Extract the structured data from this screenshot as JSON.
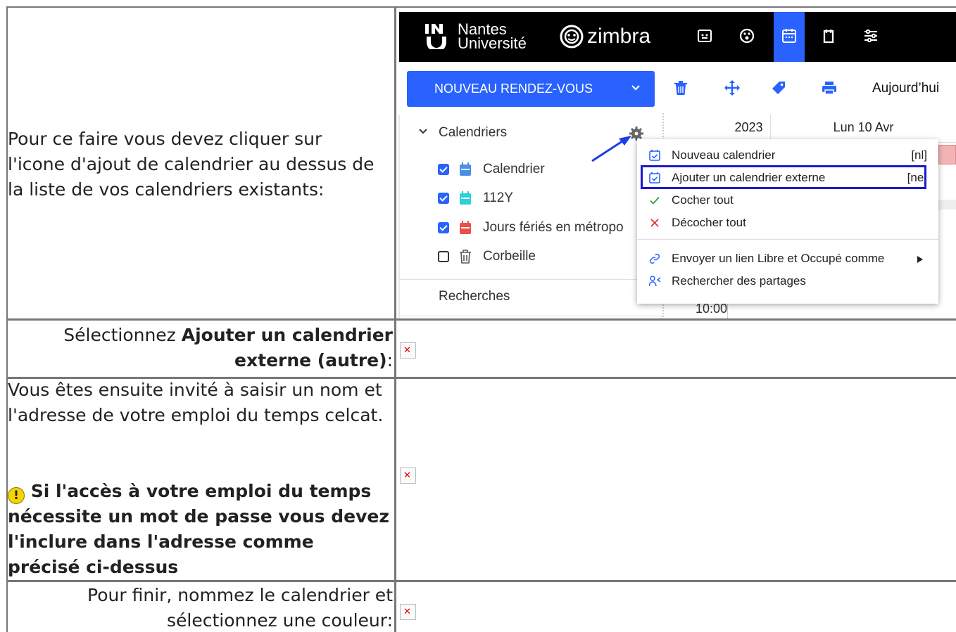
{
  "rows": [
    {
      "text": "Pour ce faire vous devez cliquer sur l'icone d'ajout de calendrier au dessus de la liste de vos calendriers existants:"
    },
    {
      "prefix": "Sélectionnez ",
      "bold": "Ajouter un calendrier externe (autre)",
      "suffix": ":"
    },
    {
      "text": "Vous êtes ensuite invité à saisir un nom et l'adresse de votre emploi du temps celcat.",
      "warning": "Si l'accès à votre emploi du temps nécessite un mot de passe vous devez l'inclure dans l'adresse comme précisé ci-dessus"
    },
    {
      "text": "Pour finir, nommez le calendrier et sélectionnez une couleur:"
    }
  ],
  "zimbra": {
    "brand_line1": "Nantes",
    "brand_line2": "Université",
    "zimbra_label": "zimbra",
    "new_button": "NOUVEAU RENDEZ-VOUS",
    "today": "Aujourd’hui",
    "calendars_header": "Calendriers",
    "calendars": [
      {
        "name": "Calendrier",
        "checked": true,
        "color": "#4a8fe7"
      },
      {
        "name": "112Y",
        "checked": true,
        "color": "#2ecfd8"
      },
      {
        "name": "Jours fériés en métropo",
        "checked": true,
        "color": "#e8504a"
      },
      {
        "name": "Corbeille",
        "checked": false,
        "color": "#555555"
      }
    ],
    "searches": "Recherches",
    "cal_year": "2023",
    "cal_day": "Lun 10 Avr",
    "cal_time": "10:00",
    "menu": [
      {
        "label": "Nouveau calendrier",
        "shortcut": "[nl]",
        "icon": "calendar-check-icon"
      },
      {
        "label": "Ajouter un calendrier externe",
        "shortcut": "[ne]",
        "icon": "calendar-check-icon"
      },
      {
        "label": "Cocher tout",
        "shortcut": "",
        "icon": "check-icon"
      },
      {
        "label": "Décocher tout",
        "shortcut": "",
        "icon": "close-icon"
      },
      {
        "label": "Envoyer un lien Libre et Occupé comme",
        "shortcut": "",
        "icon": "link-icon"
      },
      {
        "label": "Rechercher des partages",
        "shortcut": "",
        "icon": "share-search-icon"
      }
    ],
    "accent": "#2962ff"
  }
}
